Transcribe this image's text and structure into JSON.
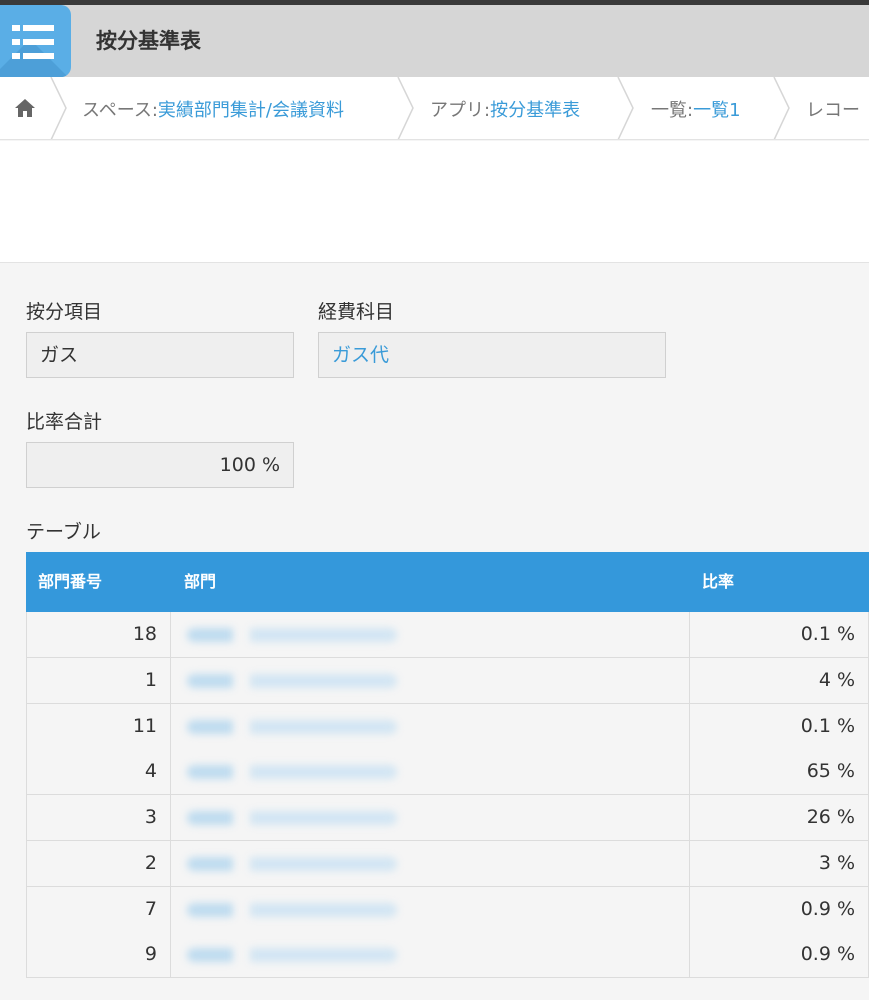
{
  "app": {
    "title": "按分基準表",
    "icon": "list-icon",
    "accent": "#3498db"
  },
  "breadcrumb": {
    "home_icon": "home-icon",
    "items": [
      {
        "label": "スペース: ",
        "link": "実績部門集計/会議資料"
      },
      {
        "label": "アプリ: ",
        "link": "按分基準表"
      },
      {
        "label": "一覧: ",
        "link": "一覧1"
      },
      {
        "label": "レコー",
        "link": ""
      }
    ]
  },
  "form": {
    "allocation_item": {
      "label": "按分項目",
      "value": "ガス"
    },
    "expense_account": {
      "label": "経費科目",
      "value": "ガス代"
    },
    "ratio_total": {
      "label": "比率合計",
      "value": "100 %"
    }
  },
  "table": {
    "title": "テーブル",
    "columns": [
      "部門番号",
      "部門",
      "比率"
    ],
    "rows": [
      {
        "dept_no": "18",
        "ratio": "0.1 %"
      },
      {
        "dept_no": "1",
        "ratio": "4 %"
      },
      {
        "dept_no": "11",
        "ratio": "0.1 %"
      },
      {
        "dept_no": "4",
        "ratio": "65 %"
      },
      {
        "dept_no": "3",
        "ratio": "26 %"
      },
      {
        "dept_no": "2",
        "ratio": "3 %"
      },
      {
        "dept_no": "7",
        "ratio": "0.9 %"
      },
      {
        "dept_no": "9",
        "ratio": "0.9 %"
      }
    ]
  }
}
